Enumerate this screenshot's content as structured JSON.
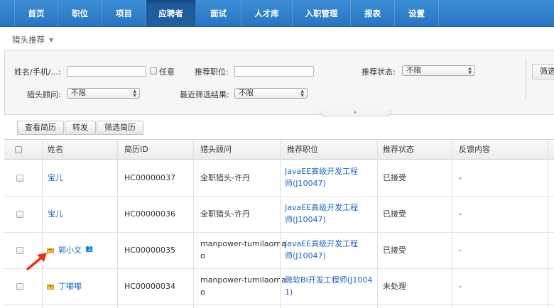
{
  "nav": {
    "items": [
      "首页",
      "职位",
      "项目",
      "应聘者",
      "面试",
      "人才库",
      "入职管理",
      "报表",
      "设置"
    ],
    "active_index": 3
  },
  "breadcrumb": {
    "title": "猎头推荐"
  },
  "filters": {
    "name_label": "姓名/手机/...:",
    "name_value": "",
    "any_label": "任意",
    "position_label": "推荐职位:",
    "position_value": "",
    "status_label": "推荐状态:",
    "status_value": "不限",
    "advisor_label": "猎头顾问:",
    "advisor_value": "不限",
    "screen_label": "最近筛选结果:",
    "screen_value": "不限",
    "side_button": "筛选"
  },
  "actions": [
    "查看简历",
    "转发",
    "筛选简历"
  ],
  "table": {
    "headers": [
      "姓名",
      "简历ID",
      "猎头顾问",
      "推荐职位",
      "推荐状态",
      "反馈内容"
    ],
    "rows": [
      {
        "name": "宝儿",
        "id": "HC00000037",
        "advisor": "全职猎头-许丹",
        "position_l1": "JavaEE高级开发工程",
        "position_l2": "师(J10047)",
        "status": "已接受",
        "feedback": "-",
        "mail": false,
        "people": false
      },
      {
        "name": "宝儿",
        "id": "HC00000036",
        "advisor": "全职猎头-许丹",
        "position_l1": "JavaEE高级开发工程",
        "position_l2": "师(J10047)",
        "status": "已接受",
        "feedback": "-",
        "mail": false,
        "people": false
      },
      {
        "name": "郭小文",
        "id": "HC00000035",
        "advisor": "manpower-tumilaoma",
        "advisor_l2": "o",
        "position_l1": "JavaEE高级开发工程",
        "position_l2": "师(J10047)",
        "status": "已接受",
        "feedback": "-",
        "mail": true,
        "people": true
      },
      {
        "name": "丁嘟嘟",
        "id": "HC00000034",
        "advisor": "manpower-tumilaoma",
        "advisor_l2": "o",
        "position_l1": "微软BI开发工程师(J1004",
        "position_l2": "1)",
        "status": "未处理",
        "feedback": "-",
        "mail": true,
        "people": false
      }
    ]
  },
  "colors": {
    "nav": "#2a74c2",
    "link": "#2266bb",
    "arrow": "#e8321a"
  }
}
